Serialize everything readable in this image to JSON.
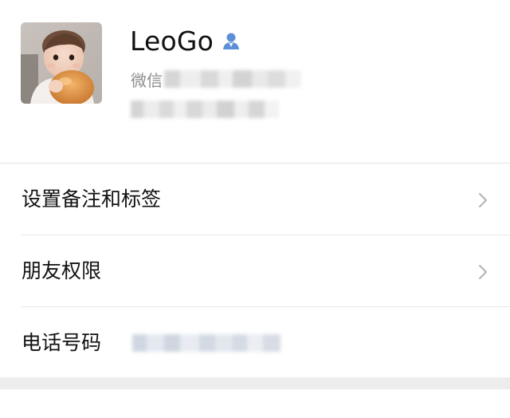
{
  "profile": {
    "name": "LeoGo",
    "name_icon": "contact-person-icon",
    "wechat_id_label": "微信",
    "avatar": "baby-photo-avatar"
  },
  "menu": {
    "items": [
      {
        "label": "设置备注和标签",
        "icon": "chevron-right-icon"
      },
      {
        "label": "朋友权限",
        "icon": "chevron-right-icon"
      },
      {
        "label": "电话号码"
      }
    ]
  },
  "colors": {
    "background": "#ffffff",
    "divider": "#e6e6e6",
    "separator_band": "#ededed",
    "secondary_text": "#8c8c8c",
    "chevron": "#b2b2b2",
    "contact_icon": "#5b8fd6"
  }
}
